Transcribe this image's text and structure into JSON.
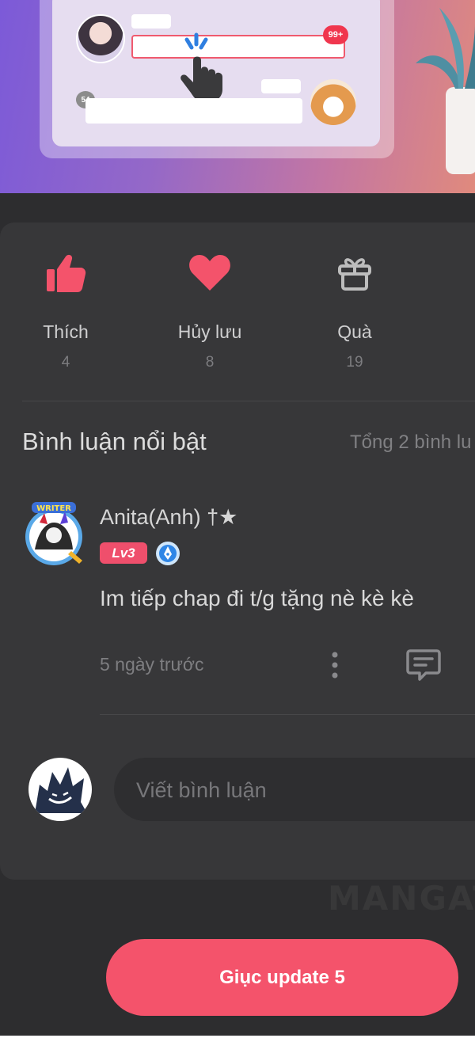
{
  "banner": {
    "notification_badge": "99+",
    "count_badge": "54"
  },
  "actions": [
    {
      "label": "Thích",
      "count": "4",
      "icon": "thumbs-up-icon",
      "color": "#f4536b"
    },
    {
      "label": "Hủy lưu",
      "count": "8",
      "icon": "heart-icon",
      "color": "#f4536b"
    },
    {
      "label": "Quà",
      "count": "19",
      "icon": "gift-icon",
      "color": "#bdbdbd"
    }
  ],
  "comments_section": {
    "title": "Bình luận nổi bật",
    "total": "Tổng 2 bình lu"
  },
  "comment": {
    "username": "Anita(Anh) †★",
    "level": "Lv3",
    "text": "Im tiếp chap đi t/g tặng nè kè kè",
    "time": "5 ngày trước",
    "avatar_frame_label": "WRITER"
  },
  "compose": {
    "placeholder": "Viết bình luận"
  },
  "watermark": "MANGAT",
  "cta": {
    "label": "Giục update 5",
    "color": "#f4536b"
  }
}
